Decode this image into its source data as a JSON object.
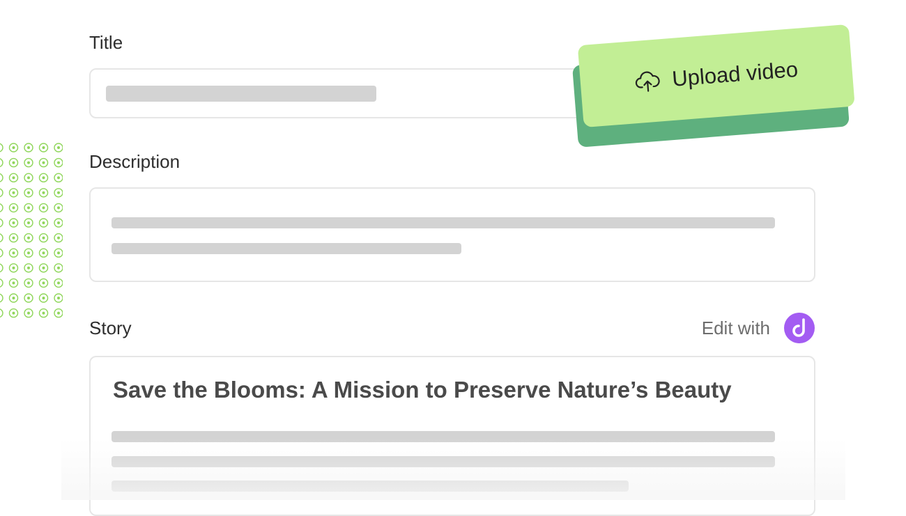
{
  "form": {
    "title_label": "Title",
    "description_label": "Description",
    "story_label": "Story",
    "edit_with_label": "Edit with",
    "story_heading": "Save the Blooms: A Mission to Preserve Nature’s Beauty"
  },
  "upload": {
    "label": "Upload video",
    "icon": "cloud-upload-icon"
  },
  "edit_with_logo": {
    "icon": "d-logo-icon"
  },
  "colors": {
    "upload_button": "#c2ee95",
    "upload_shadow": "#5eb07e",
    "logo": "#a35cf2",
    "placeholder_bar": "#d3d3d3",
    "dot_pattern": "#8fd65a"
  }
}
